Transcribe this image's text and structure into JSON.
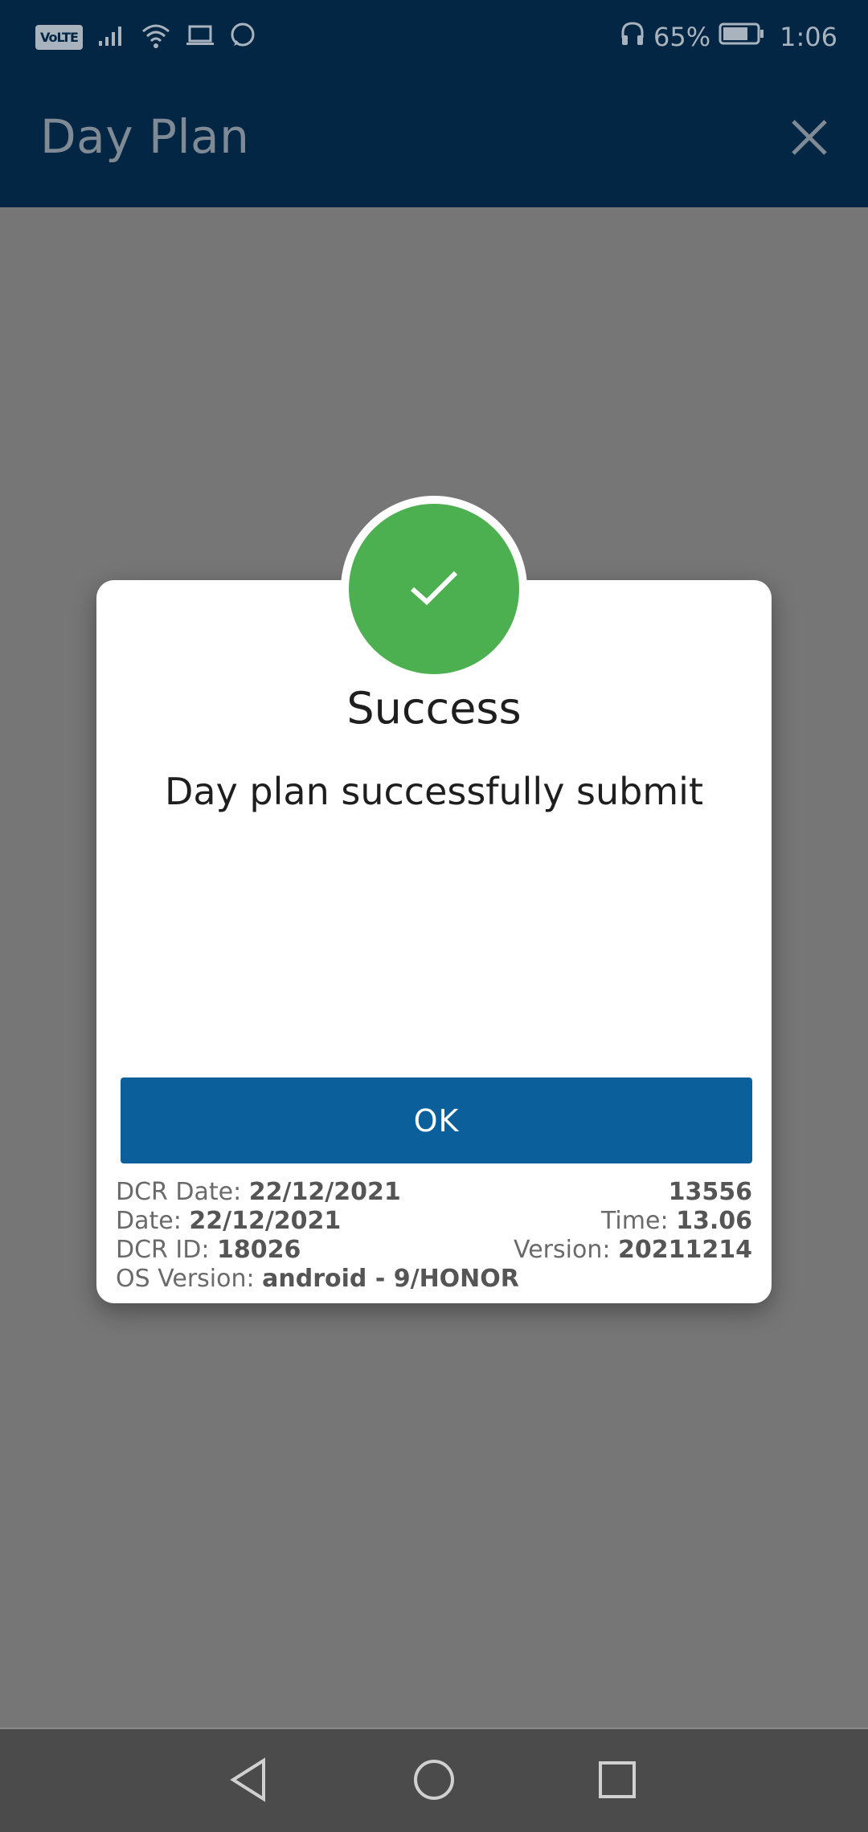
{
  "status_bar": {
    "volte": "VoLTE",
    "battery_percent": "65%",
    "time": "1:06",
    "icons": [
      "signal-icon",
      "wifi-icon",
      "laptop-icon",
      "whatsapp-icon",
      "headphones-icon",
      "battery-icon"
    ]
  },
  "app_bar": {
    "title": "Day Plan",
    "close_icon": "close-icon",
    "background": "#022643"
  },
  "dialog": {
    "badge_icon": "checkmark-icon",
    "badge_color": "#4cb050",
    "title": "Success",
    "message": "Day plan successfully submit",
    "ok_label": "OK",
    "ok_color": "#0b609b",
    "meta_left": [
      {
        "label": "DCR Date: ",
        "value": "22/12/2021"
      },
      {
        "label": "Date: ",
        "value": "22/12/2021"
      },
      {
        "label": "DCR ID: ",
        "value": "18026"
      },
      {
        "label": "OS Version: ",
        "value": "android - 9/HONOR"
      }
    ],
    "meta_right": [
      {
        "label": "",
        "value": "13556"
      },
      {
        "label": "Time: ",
        "value": "13.06"
      },
      {
        "label": "Version: ",
        "value": "20211214"
      }
    ]
  },
  "nav_bar": {
    "icons": [
      "back-icon",
      "home-icon",
      "recents-icon"
    ]
  }
}
